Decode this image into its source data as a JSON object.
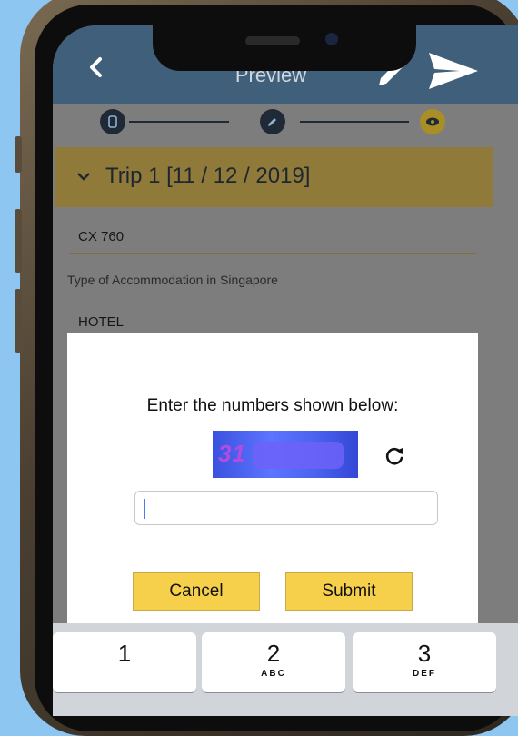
{
  "header": {
    "title": "Preview"
  },
  "stepper": {
    "active_color": "#f0c832",
    "inactive_color": "#2a4f72"
  },
  "trip": {
    "title": "Trip 1 [11 / 12 / 2019]"
  },
  "fields": {
    "flight": "CX 760",
    "accommodation_label": "Type of Accommodation in Singapore",
    "accommodation_value": "HOTEL"
  },
  "dialog": {
    "prompt": "Enter the numbers shown below:",
    "captcha_visible": "31",
    "input_value": "",
    "cancel_label": "Cancel",
    "submit_label": "Submit"
  },
  "keyboard": {
    "keys": [
      {
        "num": "1",
        "letters": ""
      },
      {
        "num": "2",
        "letters": "ABC"
      },
      {
        "num": "3",
        "letters": "DEF"
      }
    ]
  }
}
